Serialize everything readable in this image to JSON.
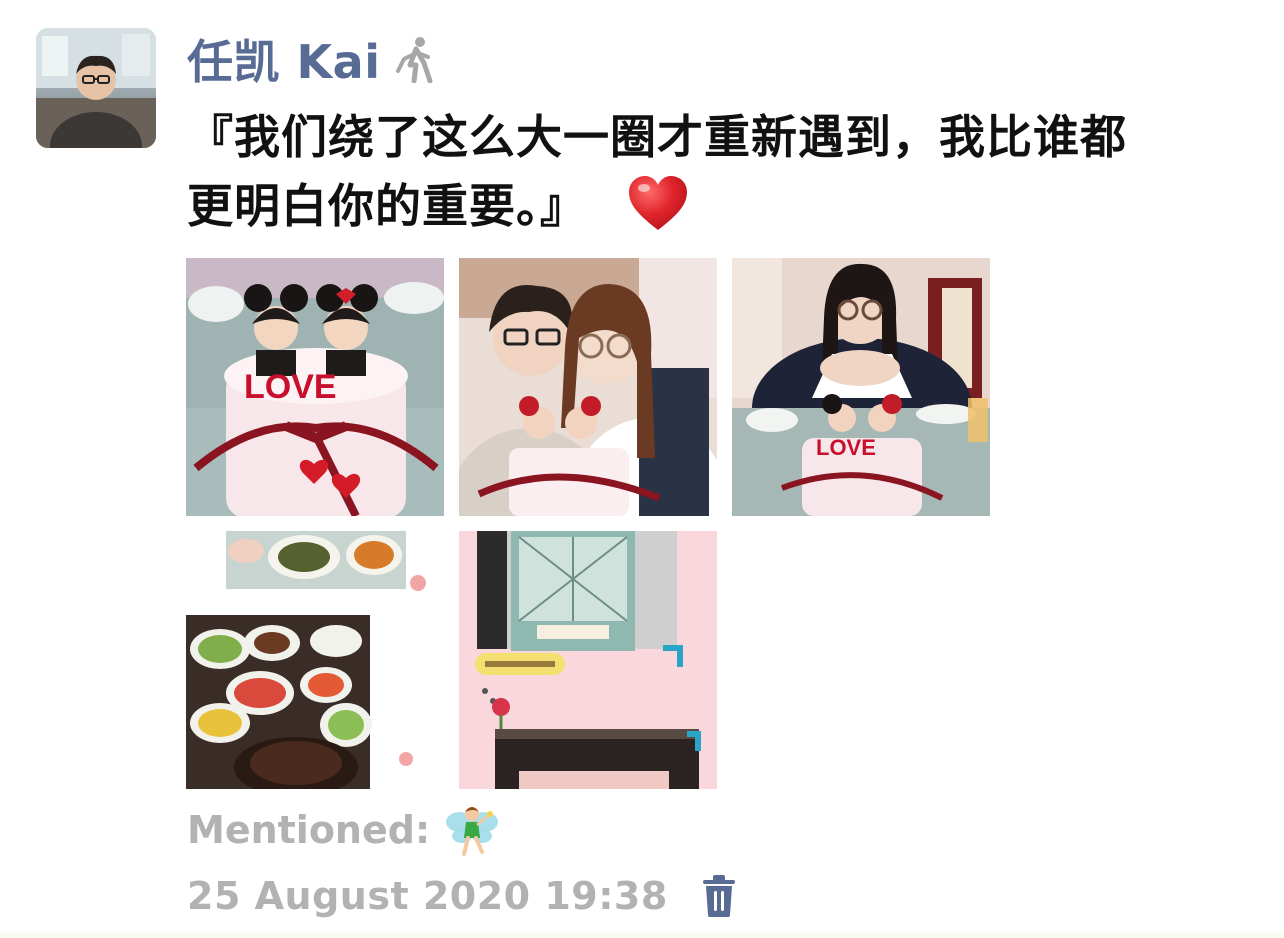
{
  "post": {
    "author_name": "任凯 Kai",
    "text_line_1": "『我们绕了这么大一圈才重新遇到，我比谁都",
    "text_line_2": "更明白你的重要。』",
    "photos": [
      {
        "icon": "photo-cake-love",
        "cake_text": "LOVE"
      },
      {
        "icon": "photo-couple-with-cake"
      },
      {
        "icon": "photo-girl-with-cake",
        "cake_text": "LOVE"
      },
      {
        "icon": "photo-food-collage"
      },
      {
        "icon": "photo-pink-card-collage"
      }
    ],
    "mentioned_label": "Mentioned:",
    "timestamp": "25 August 2020 19:38"
  },
  "icons": {
    "avatar": "user-avatar",
    "status": "walking-person-icon",
    "emoji": "red-heart-icon",
    "mention": "fairy-icon",
    "delete": "trash-icon"
  },
  "colors": {
    "author": "#576b95",
    "body_text": "#111111",
    "meta_text": "#b2b2b2",
    "trash": "#576b95",
    "heart": "#e0242b"
  }
}
